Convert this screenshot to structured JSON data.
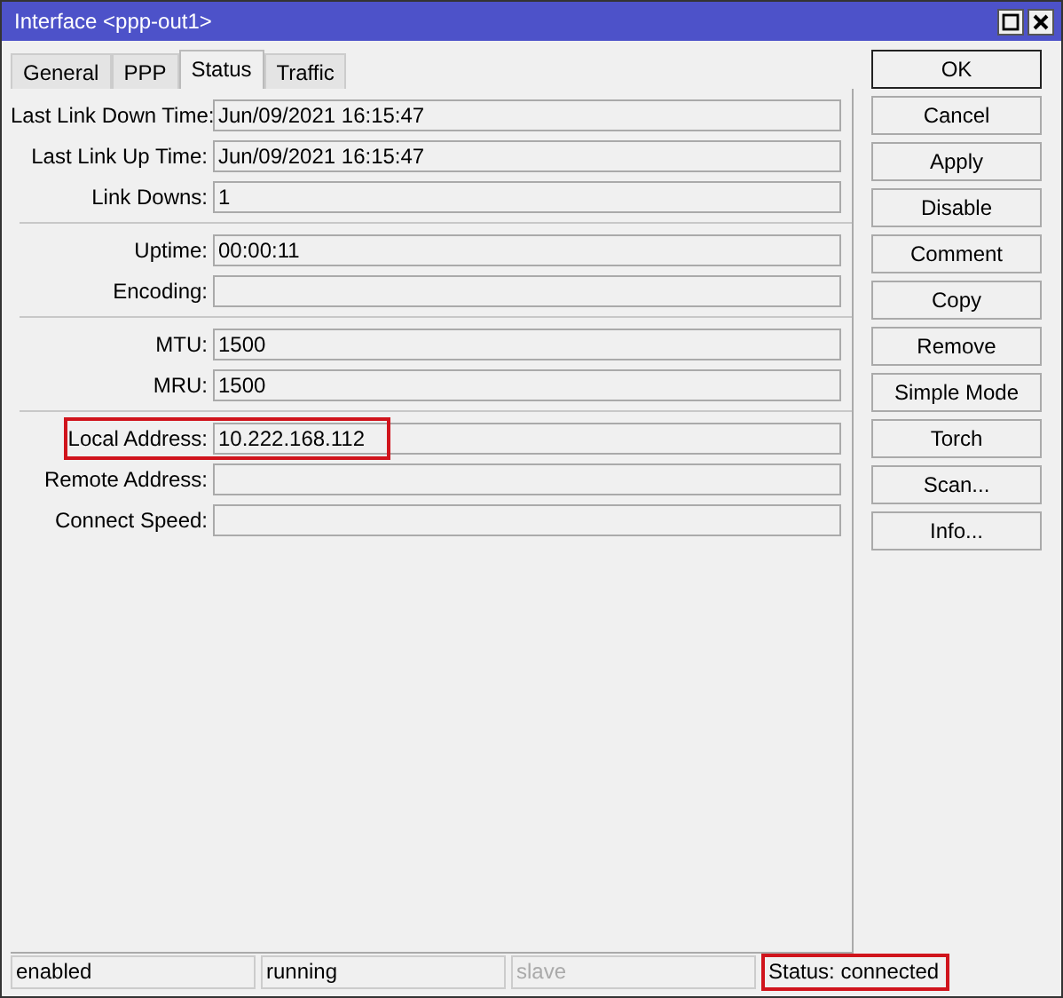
{
  "window": {
    "title": "Interface <ppp-out1>"
  },
  "tabs": [
    {
      "label": "General",
      "selected": false
    },
    {
      "label": "PPP",
      "selected": false
    },
    {
      "label": "Status",
      "selected": true
    },
    {
      "label": "Traffic",
      "selected": false
    }
  ],
  "field_groups": [
    {
      "fields": [
        {
          "label": "Last Link Down Time:",
          "value": "Jun/09/2021 16:15:47",
          "highlighted": false
        },
        {
          "label": "Last Link Up Time:",
          "value": "Jun/09/2021 16:15:47",
          "highlighted": false
        },
        {
          "label": "Link Downs:",
          "value": "1",
          "highlighted": false
        }
      ]
    },
    {
      "fields": [
        {
          "label": "Uptime:",
          "value": "00:00:11",
          "highlighted": false
        },
        {
          "label": "Encoding:",
          "highlighted": false
        }
      ]
    },
    {
      "fields": [
        {
          "label": "MTU:",
          "value": "1500",
          "highlighted": false
        },
        {
          "label": "MRU:",
          "value": "1500",
          "highlighted": false
        }
      ]
    },
    {
      "fields": [
        {
          "label": "Local Address:",
          "value": "10.222.168.112",
          "highlighted": true
        },
        {
          "label": "Remote Address:",
          "highlighted": false
        },
        {
          "label": "Connect Speed:",
          "highlighted": false
        }
      ]
    }
  ],
  "buttons": [
    {
      "label": "OK",
      "default": true
    },
    {
      "label": "Cancel",
      "default": false
    },
    {
      "label": "Apply",
      "default": false
    },
    {
      "label": "Disable",
      "default": false
    },
    {
      "label": "Comment",
      "default": false
    },
    {
      "label": "Copy",
      "default": false
    },
    {
      "label": "Remove",
      "default": false
    },
    {
      "label": "Simple Mode",
      "default": false
    },
    {
      "label": "Torch",
      "default": false
    },
    {
      "label": "Scan...",
      "default": false
    },
    {
      "label": "Info...",
      "default": false
    }
  ],
  "status_bar": [
    {
      "text": "enabled",
      "disabled": false,
      "highlighted": false
    },
    {
      "text": "running",
      "disabled": false,
      "highlighted": false
    },
    {
      "text": "slave",
      "disabled": true,
      "highlighted": false
    },
    {
      "text": "Status: connected",
      "disabled": false,
      "highlighted": true
    }
  ]
}
